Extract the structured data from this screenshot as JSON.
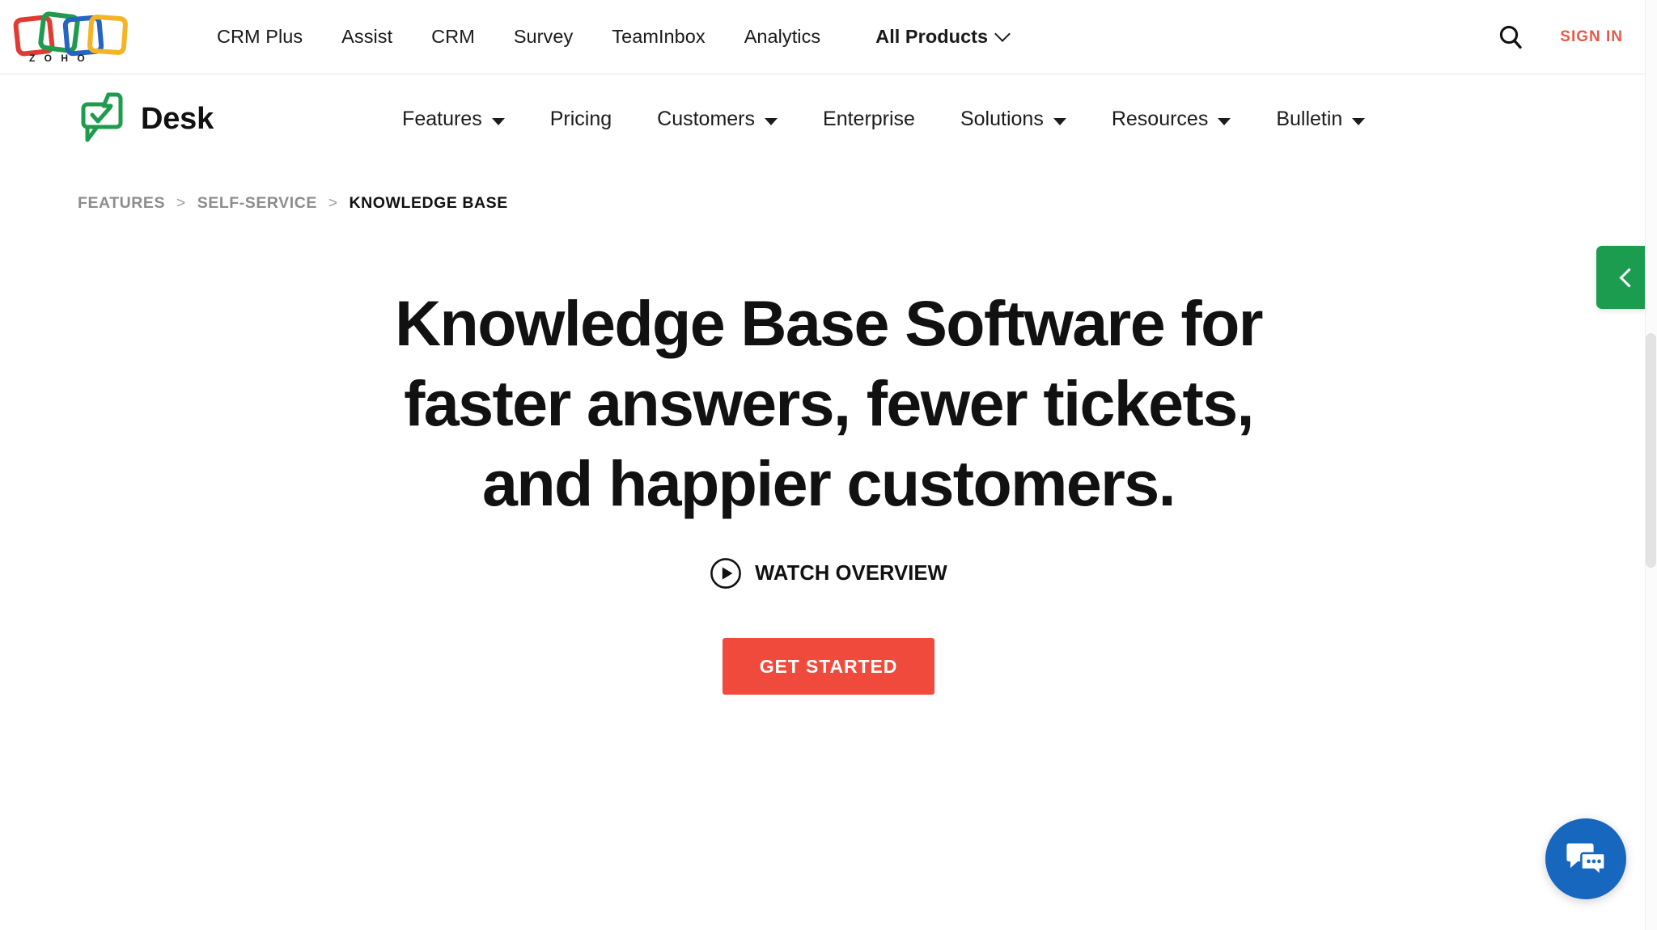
{
  "topbar": {
    "logo_name": "Zoho",
    "logo_wordmark": "ZOHO",
    "nav": [
      {
        "label": "CRM Plus",
        "has_caret": false,
        "bold": false
      },
      {
        "label": "Assist",
        "has_caret": false,
        "bold": false
      },
      {
        "label": "CRM",
        "has_caret": false,
        "bold": false
      },
      {
        "label": "Survey",
        "has_caret": false,
        "bold": false
      },
      {
        "label": "TeamInbox",
        "has_caret": false,
        "bold": false
      },
      {
        "label": "Analytics",
        "has_caret": false,
        "bold": false
      },
      {
        "label": "All Products",
        "has_caret": true,
        "bold": true
      }
    ],
    "search_icon": "search-icon",
    "signin_label": "SIGN IN",
    "signin_color": "#e8594a"
  },
  "deskbar": {
    "brand_icon": "desk-logo-icon",
    "brand_label": "Desk",
    "brand_color": "#1f9b4e",
    "nav": [
      {
        "label": "Features",
        "has_caret": true
      },
      {
        "label": "Pricing",
        "has_caret": false
      },
      {
        "label": "Customers",
        "has_caret": true
      },
      {
        "label": "Enterprise",
        "has_caret": false
      },
      {
        "label": "Solutions",
        "has_caret": true
      },
      {
        "label": "Resources",
        "has_caret": true
      },
      {
        "label": "Bulletin",
        "has_caret": true
      }
    ]
  },
  "breadcrumb": {
    "separator": ">",
    "items": [
      {
        "label": "FEATURES",
        "current": false
      },
      {
        "label": "SELF-SERVICE",
        "current": false
      },
      {
        "label": "KNOWLEDGE BASE",
        "current": true
      }
    ]
  },
  "hero": {
    "title_line1": "Knowledge Base Software for",
    "title_line2": "faster answers, fewer tickets,",
    "title_line3": "and happier customers.",
    "watch_icon": "play-circle-icon",
    "watch_label": "WATCH OVERVIEW",
    "cta_label": "GET STARTED",
    "cta_color": "#ef4a3b"
  },
  "widgets": {
    "side_tab_icon": "chevron-left-icon",
    "side_tab_color": "#1c9c4e",
    "chat_icon": "chat-bubbles-icon",
    "chat_color": "#1767bf"
  },
  "scrollbar": {
    "name": "page-scrollbar"
  }
}
